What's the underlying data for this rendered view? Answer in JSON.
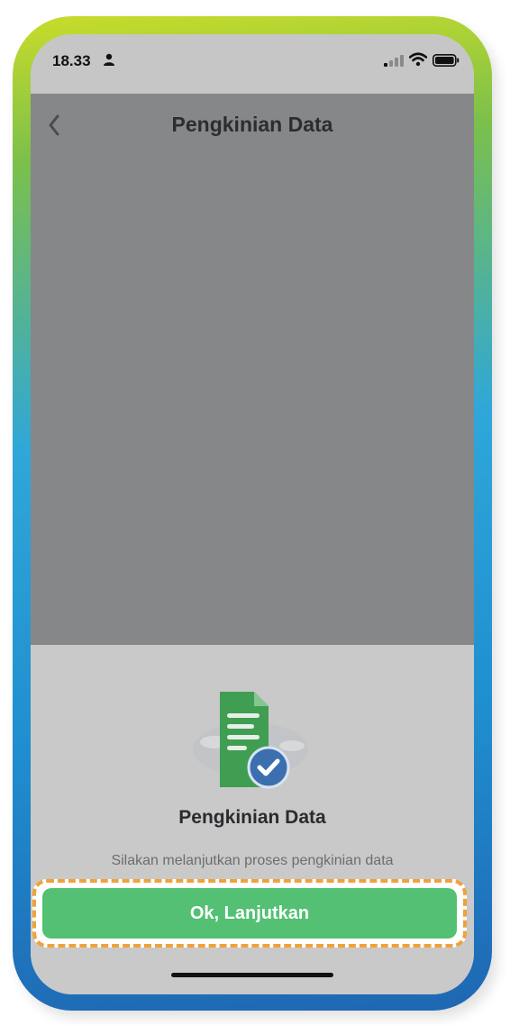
{
  "status_bar": {
    "time": "18.33",
    "icons": [
      "person-icon",
      "signal-icon",
      "wifi-icon",
      "battery-icon"
    ]
  },
  "header": {
    "title": "Pengkinian Data",
    "back_icon": "chevron-left-icon"
  },
  "sheet": {
    "illustration": "document-check-icon",
    "title": "Pengkinian Data",
    "message": "Silakan melanjutkan proses pengkinian data",
    "button_label": "Ok, Lanjutkan"
  },
  "colors": {
    "primary_button": "#53c074",
    "highlight": "#f0a23a",
    "overlay": "#868789",
    "document_green": "#3f9e52",
    "check_badge": "#3c6fb0"
  }
}
